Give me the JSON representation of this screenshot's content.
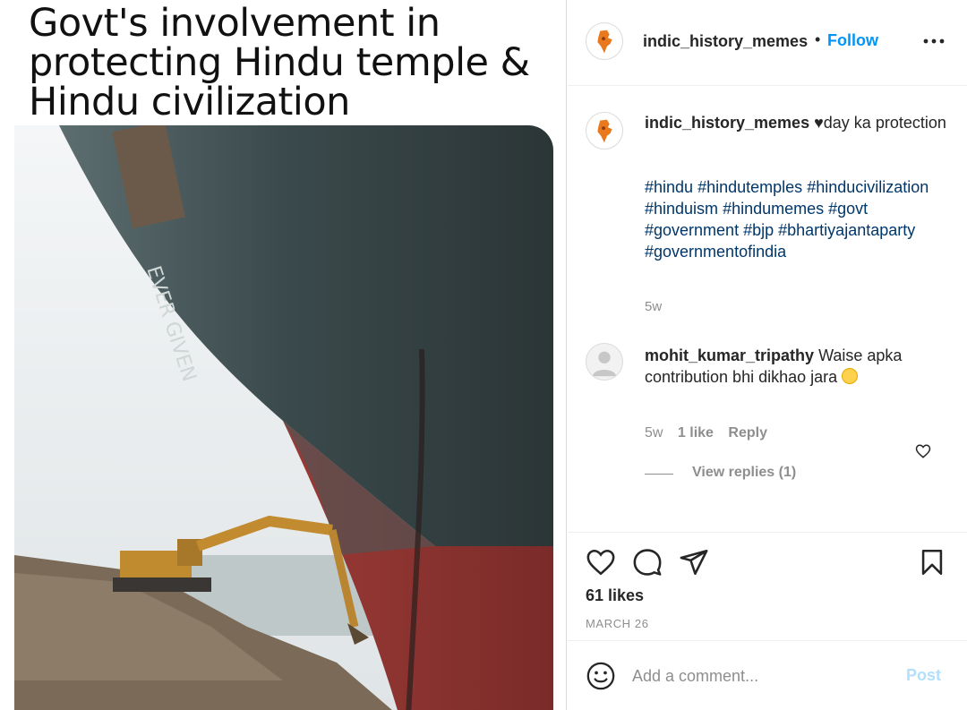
{
  "meme": {
    "caption": "Govt's involvement in protecting Hindu temple & Hindu civilization"
  },
  "header": {
    "username": "indic_history_memes",
    "separator": "•",
    "follow_label": "Follow"
  },
  "caption": {
    "username": "indic_history_memes",
    "text": "♥day ka protection",
    "hashtags": [
      "#hindu",
      "#hindutemples",
      "#hinducivilization",
      "#hinduism",
      "#hindumemes",
      "#govt",
      "#government",
      "#bjp",
      "#bhartiyajantaparty",
      "#governmentofindia"
    ],
    "time": "5w"
  },
  "comment": {
    "username": "mohit_kumar_tripathy",
    "text": "Waise apka contribution bhi dikhao jara",
    "time": "5w",
    "likes": "1 like",
    "reply_label": "Reply",
    "view_replies": "View replies (1)"
  },
  "post": {
    "likes": "61 likes",
    "date": "MARCH 26"
  },
  "composer": {
    "placeholder": "Add a comment...",
    "post_label": "Post"
  },
  "colors": {
    "link_blue": "#0095f6",
    "hashtag": "#00376b",
    "muted": "#8e8e8e",
    "post_disabled": "#b2dffc"
  }
}
